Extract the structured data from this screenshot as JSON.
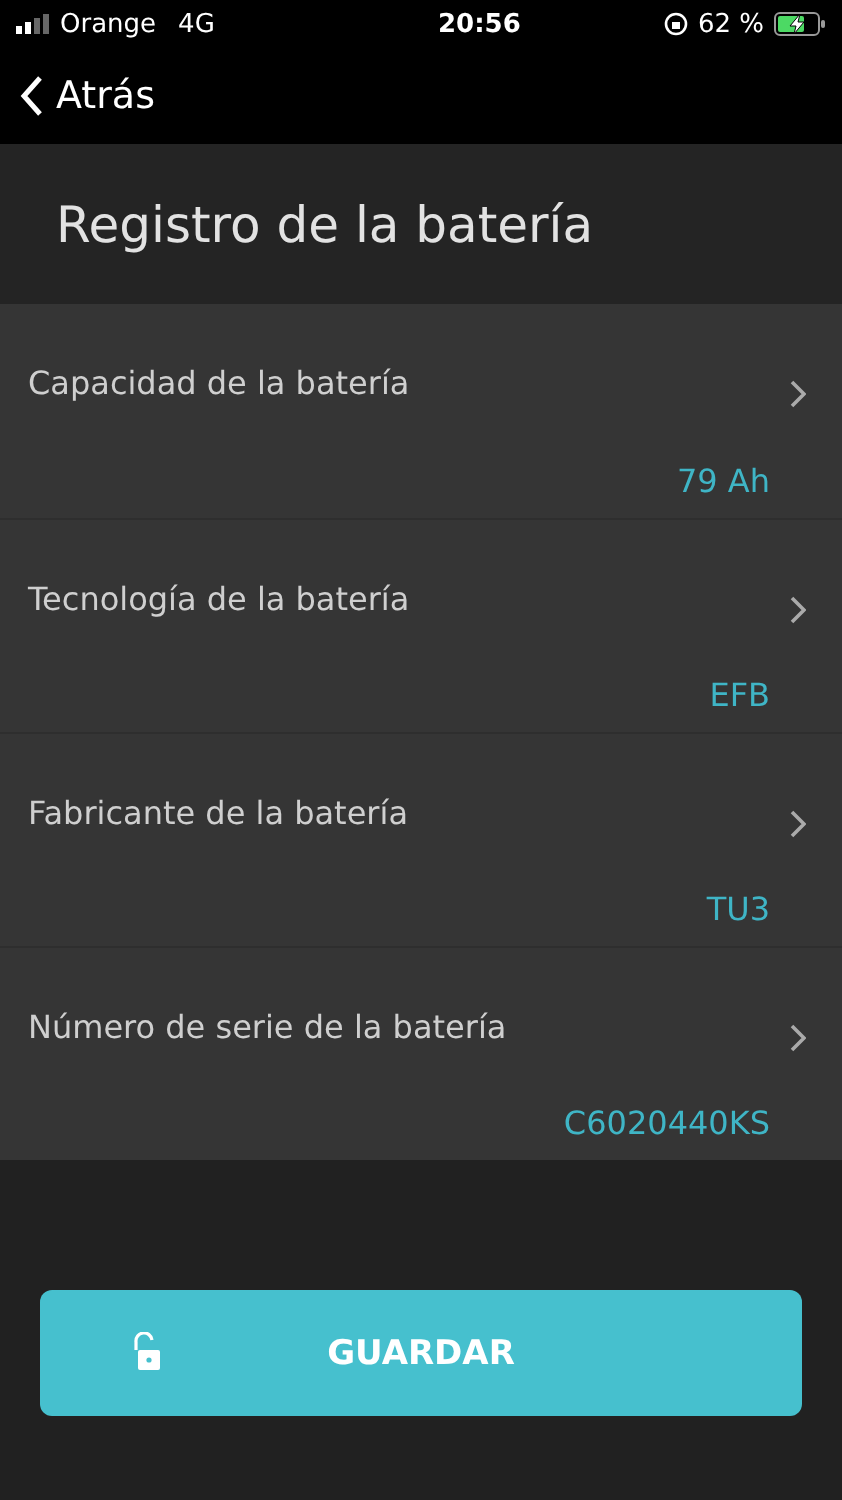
{
  "status_bar": {
    "carrier": "Orange",
    "network": "4G",
    "time": "20:56",
    "battery_percent": "62 %"
  },
  "nav": {
    "back_label": "Atrás"
  },
  "header": {
    "title": "Registro de la batería"
  },
  "fields": [
    {
      "label": "Capacidad de la batería",
      "value": "79 Ah"
    },
    {
      "label": "Tecnología de la batería",
      "value": "EFB"
    },
    {
      "label": "Fabricante de la batería",
      "value": "TU3"
    },
    {
      "label": "Número de serie de la batería",
      "value": "C6020440KS"
    }
  ],
  "save_button": {
    "label": "GUARDAR"
  }
}
